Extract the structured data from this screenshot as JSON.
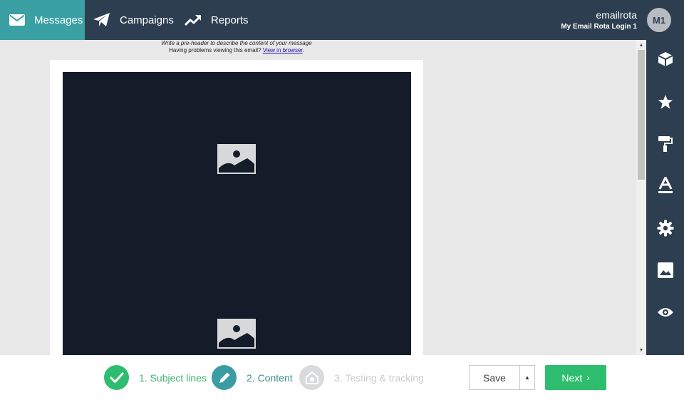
{
  "nav": {
    "items": [
      {
        "label": "Messages",
        "icon": "envelope-icon"
      },
      {
        "label": "Campaigns",
        "icon": "paper-plane-icon"
      },
      {
        "label": "Reports",
        "icon": "trending-up-icon"
      }
    ],
    "account": {
      "name": "emailrota",
      "login": "My Email Rota Login 1",
      "avatar_initials": "M1"
    }
  },
  "editor": {
    "preheader_hint": "Write a pre-header to describe the content of your message",
    "view_problem_text": "Having problems viewing this email?",
    "view_in_browser_link": "View in browser",
    "image_placeholders": [
      "image-placeholder-icon",
      "image-placeholder-icon"
    ]
  },
  "sidebar": {
    "tools": [
      "cube-icon",
      "star-icon",
      "paint-roller-icon",
      "text-color-icon",
      "gear-icon",
      "image-icon",
      "eye-icon"
    ]
  },
  "footer": {
    "steps": [
      {
        "label": "1. Subject lines",
        "state": "complete"
      },
      {
        "label": "2. Content",
        "state": "active"
      },
      {
        "label": "3. Testing & tracking",
        "state": "pending"
      }
    ],
    "save_label": "Save",
    "next_label": "Next"
  },
  "colors": {
    "nav_bg": "#2c3e50",
    "nav_active": "#3aa0a4",
    "success": "#2ebd6e",
    "canvas_bg": "#e8e8e8",
    "email_dark": "#131c28"
  }
}
